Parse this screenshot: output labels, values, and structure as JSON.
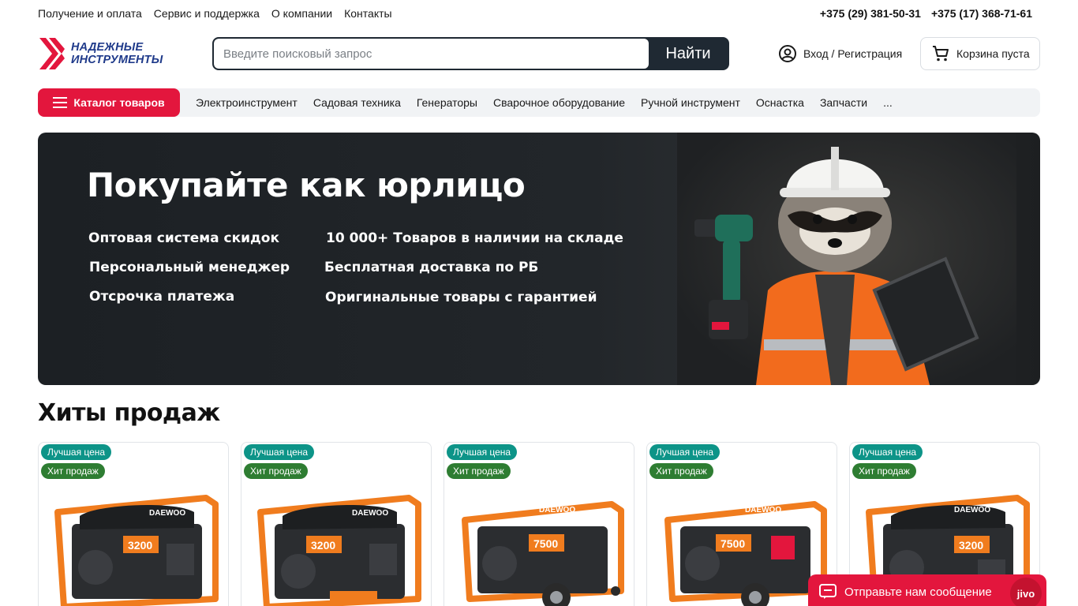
{
  "top_links": [
    "Получение и оплата",
    "Сервис и поддержка",
    "О компании",
    "Контакты"
  ],
  "phones": [
    "+375 (29) 381-50-31",
    "+375 (17) 368-71-61"
  ],
  "logo": {
    "line1": "НАДЕЖНЫЕ",
    "line2": "ИНСТРУМЕНТЫ"
  },
  "search": {
    "placeholder": "Введите поисковый запрос",
    "button": "Найти"
  },
  "login": {
    "label": "Вход / Регистрация"
  },
  "cart": {
    "label": "Корзина пуста"
  },
  "nav": {
    "catalog_label": "Каталог товаров",
    "items": [
      "Электроинструмент",
      "Садовая техника",
      "Генераторы",
      "Сварочное оборудование",
      "Ручной инструмент",
      "Оснастка",
      "Запчасти",
      "..."
    ]
  },
  "banner": {
    "title": "Покупайте как юрлицо",
    "features": [
      "Оптовая система скидок",
      "10 000+ Товаров в наличии на складе",
      "Персональный менеджер",
      "Бесплатная доставка по РБ",
      "Отсрочка платежа",
      "Оригинальные товары с гарантией"
    ]
  },
  "section_title": "Хиты продаж",
  "products": [
    {
      "badges": [
        "Лучшая цена",
        "Хит продаж"
      ],
      "brand": "DAEWOO",
      "power": "3200"
    },
    {
      "badges": [
        "Лучшая цена",
        "Хит продаж"
      ],
      "brand": "DAEWOO",
      "power": "3200"
    },
    {
      "badges": [
        "Лучшая цена",
        "Хит продаж"
      ],
      "brand": "DAEWOO",
      "power": "7500"
    },
    {
      "badges": [
        "Лучшая цена",
        "Хит продаж"
      ],
      "brand": "DAEWOO",
      "power": "7500"
    },
    {
      "badges": [
        "Лучшая цена",
        "Хит продаж"
      ],
      "brand": "DAEWOO",
      "power": "3200"
    }
  ],
  "chat": {
    "label": "Отправьте нам сообщение",
    "brand": "jivo"
  },
  "colors": {
    "accent": "#e3163d",
    "dark": "#1f2933",
    "badge_teal": "#0d9488",
    "badge_green": "#2e7d32",
    "generator_orange": "#f07c1e"
  }
}
